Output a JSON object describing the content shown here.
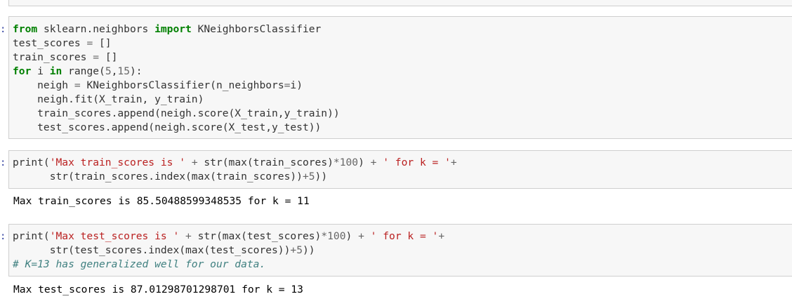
{
  "cells": [
    {
      "prompt": ":",
      "lines": [
        "from sklearn.neighbors import KNeighborsClassifier",
        "test_scores = []",
        "train_scores = []",
        "for i in range(5,15):",
        "    neigh = KNeighborsClassifier(n_neighbors=i)",
        "    neigh.fit(X_train, y_train)",
        "    train_scores.append(neigh.score(X_train,y_train))",
        "    test_scores.append(neigh.score(X_test,y_test))"
      ]
    },
    {
      "prompt": ":",
      "lines": [
        "print('Max train_scores is ' + str(max(train_scores)*100) + ' for k = '+",
        "      str(train_scores.index(max(train_scores))+5))"
      ],
      "output": "Max train_scores is 85.50488599348535 for k = 11"
    },
    {
      "prompt": ":",
      "lines": [
        "print('Max test_scores is ' + str(max(test_scores)*100) + ' for k = '+",
        "      str(test_scores.index(max(test_scores))+5))",
        "# K=13 has generalized well for our data."
      ],
      "output": "Max test_scores is 87.01298701298701 for k = 13"
    }
  ]
}
